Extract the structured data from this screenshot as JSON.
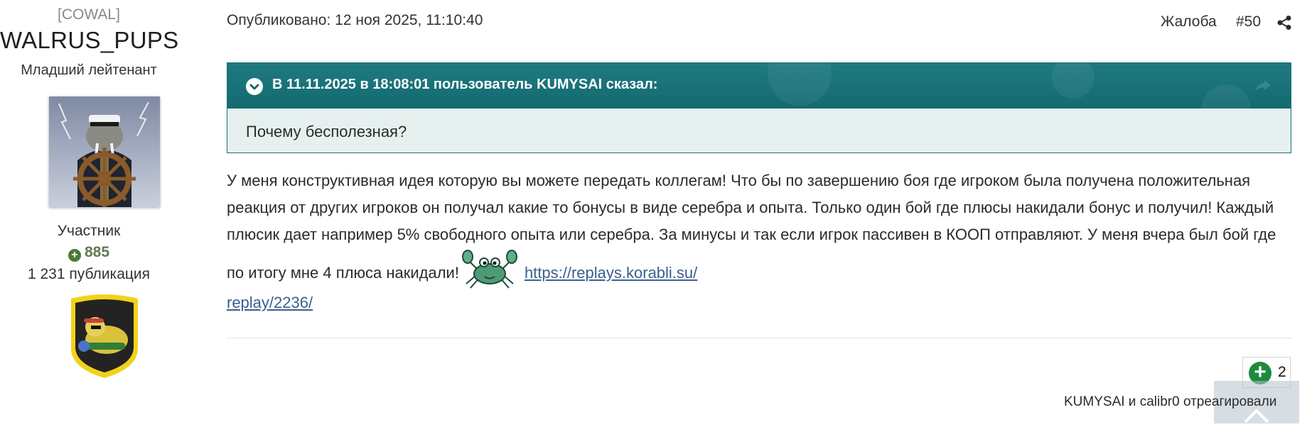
{
  "author": {
    "clan": "[COWAL]",
    "username": "WALRUS_PUPS",
    "rank": "Младший лейтенант",
    "group": "Участник",
    "reputation": "885",
    "posts": "1 231 публикация"
  },
  "post": {
    "published": "Опубликовано: 12 ноя 2025, 11:10:40",
    "report_label": "Жалоба",
    "number": "#50",
    "quote": {
      "title": "В 11.11.2025 в 18:08:01 пользователь KUMYSAI сказал:",
      "text": "Почему бесполезная?"
    },
    "body": "У меня конструктивная идея которую вы можете передать коллегам! Что бы по завершению боя где игроком была получена положительная реакция от других игроков он получал какие то бонусы в виде серебра и опыта. Только один бой где плюсы накидали бонус и получил! Каждый плюсик дает например 5% свободного опыта или серебра. За минусы и так если игрок пассивен в КООП отправляют. У меня вчера был бой где по итогу мне 4 плюса накидали!",
    "link_line1": "https://replays.korabli.su/",
    "link_line2": "replay/2236/",
    "link": "https://replays.korabli.su/replay/2236/"
  },
  "reactions": {
    "count": "2",
    "reacted_text": "KUMYSAI и calibr0 отреагировали"
  },
  "icons": {
    "share": "share-icon",
    "quote_expand": "chevron-down-icon",
    "quote_go": "reply-arrow-icon",
    "reaction": "plus-circle-icon",
    "emoji": "crab-emoji"
  },
  "colors": {
    "quote_header": "#146a71",
    "quote_bg": "#e6f0ef",
    "link": "#3a5f8e",
    "reaction": "#1e8a3c",
    "reputation": "#5f7a4f"
  }
}
